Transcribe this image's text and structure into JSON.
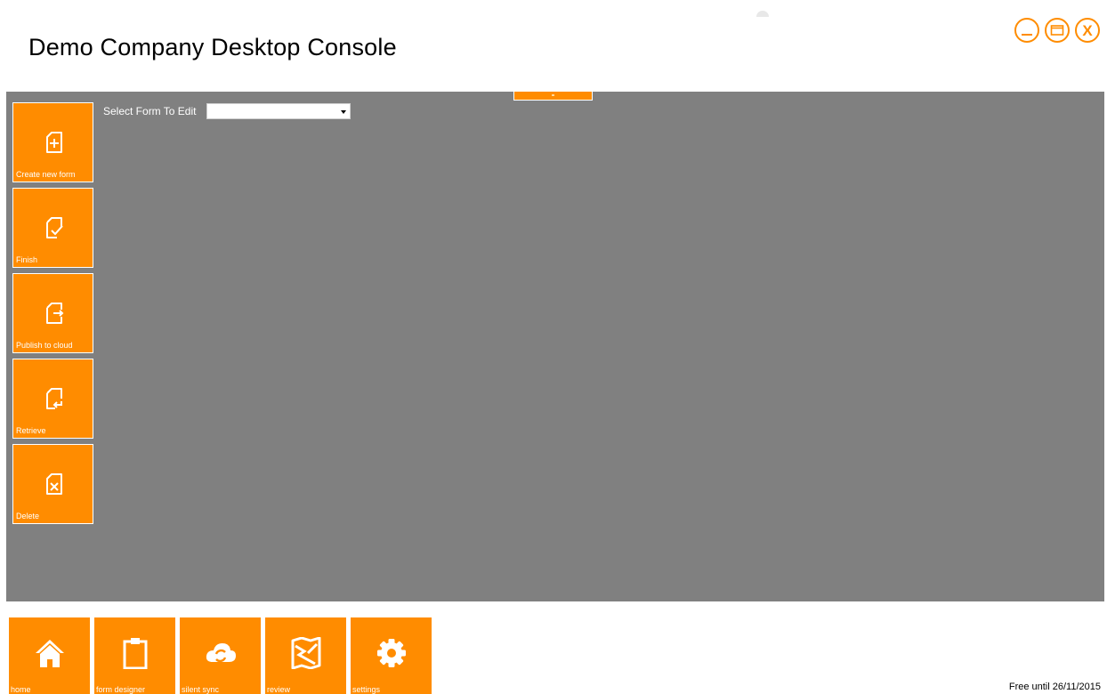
{
  "app": {
    "title": "Demo Company Desktop Console",
    "accent_color": "#FF8C00",
    "workspace_color": "#808080"
  },
  "window_controls": {
    "minimize": {
      "icon": "minimize-icon"
    },
    "maximize": {
      "icon": "maximize-icon"
    },
    "close": {
      "icon": "close-icon",
      "glyph": "X"
    }
  },
  "sidebar": {
    "tiles": [
      {
        "label": "Create new form",
        "icon": "file-plus-icon"
      },
      {
        "label": "Finish",
        "icon": "file-check-icon"
      },
      {
        "label": "Publish to cloud",
        "icon": "file-export-icon"
      },
      {
        "label": "Retrieve",
        "icon": "file-import-icon"
      },
      {
        "label": "Delete",
        "icon": "file-delete-icon"
      }
    ]
  },
  "form_select": {
    "label": "Select Form To Edit",
    "value": ""
  },
  "bottom_nav": {
    "items": [
      {
        "label": "home",
        "icon": "home-icon"
      },
      {
        "label": "form designer",
        "icon": "clipboard-icon"
      },
      {
        "label": "silent sync",
        "icon": "cloud-sync-icon"
      },
      {
        "label": "review",
        "icon": "map-review-icon"
      },
      {
        "label": "settings",
        "icon": "gear-icon"
      }
    ]
  },
  "status": {
    "license": "Free until 26/11/2015"
  }
}
